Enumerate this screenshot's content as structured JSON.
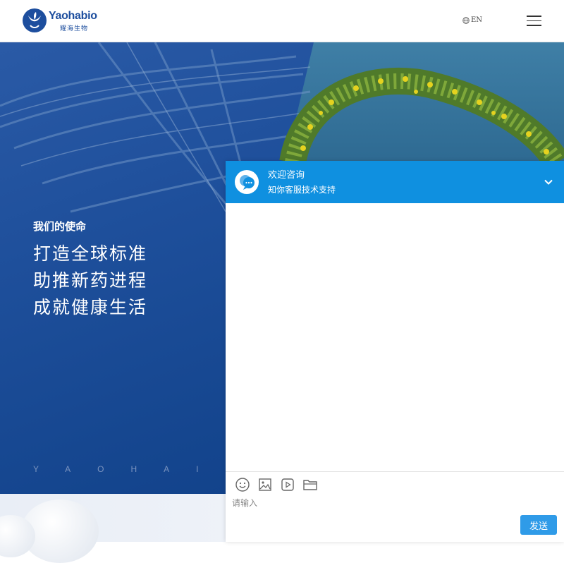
{
  "header": {
    "logo_text_en": "Yaohabio",
    "logo_text_cn": "耀海生物",
    "lang_icon": "globe-icon",
    "lang_label": "EN",
    "menu_icon": "hamburger-icon"
  },
  "hero": {
    "mission_label": "我们的使命",
    "mission_lines": [
      "打造全球标准",
      "助推新药进程",
      "成就健康生活"
    ],
    "letters": "YAOHAI"
  },
  "chat": {
    "title": "欢迎咨询",
    "subtitle": "知你客服技术支持",
    "avatar_icon": "chat-bubble-icon",
    "collapse_icon": "chevron-down-icon",
    "toolbar": [
      "emoji-icon",
      "image-icon",
      "video-icon",
      "folder-icon"
    ],
    "input_placeholder": "请输入",
    "send_label": "发送"
  },
  "colors": {
    "brand": "#1d4e9e",
    "hero_blue": "#1e4f9b",
    "chat_header": "#0f90e0",
    "send_button": "#2f9be8"
  }
}
